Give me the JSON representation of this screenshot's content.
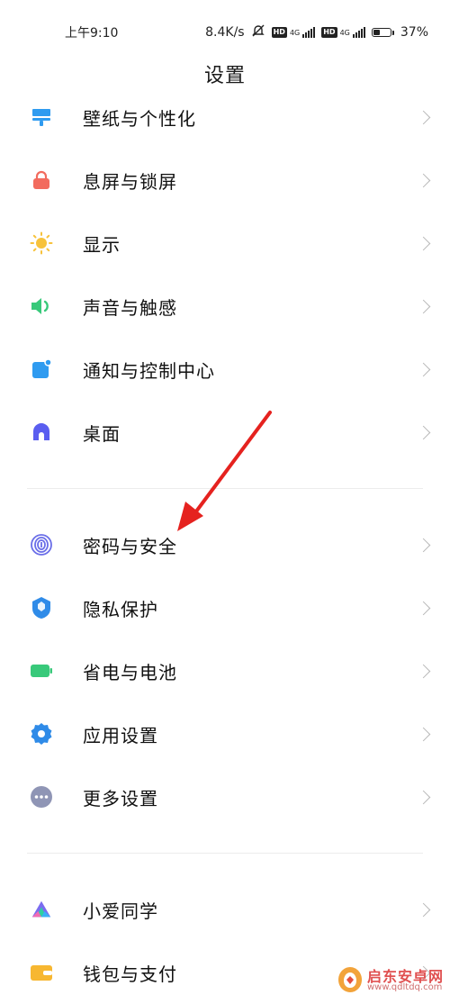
{
  "status": {
    "time": "上午9:10",
    "speed": "8.4K/s",
    "sim1": "HD",
    "net1": "4G",
    "sim2": "HD",
    "net2": "4G",
    "battery": "37%",
    "battery_level": 0.37
  },
  "page": {
    "title": "设置"
  },
  "groups": [
    {
      "items": [
        {
          "label": "壁纸与个性化",
          "icon": "wallpaper-icon",
          "color": "#2f9bf0"
        },
        {
          "label": "息屏与锁屏",
          "icon": "lock-icon",
          "color": "#f26b5e"
        },
        {
          "label": "显示",
          "icon": "sun-icon",
          "color": "#f7c23b"
        },
        {
          "label": "声音与触感",
          "icon": "speaker-icon",
          "color": "#38c97a"
        },
        {
          "label": "通知与控制中心",
          "icon": "notification-icon",
          "color": "#2f9bf0"
        },
        {
          "label": "桌面",
          "icon": "home-icon",
          "color": "#5a5ef0"
        }
      ]
    },
    {
      "items": [
        {
          "label": "密码与安全",
          "icon": "fingerprint-icon",
          "color": "#6a6ee8"
        },
        {
          "label": "隐私保护",
          "icon": "privacy-shield-icon",
          "color": "#2f8be8"
        },
        {
          "label": "省电与电池",
          "icon": "battery-icon",
          "color": "#38c97a"
        },
        {
          "label": "应用设置",
          "icon": "gear-icon",
          "color": "#2f8be8"
        },
        {
          "label": "更多设置",
          "icon": "more-icon",
          "color": "#8f95b5"
        }
      ]
    },
    {
      "items": [
        {
          "label": "小爱同学",
          "icon": "xiaoai-icon",
          "color": "#5a7cf0"
        },
        {
          "label": "钱包与支付",
          "icon": "wallet-icon",
          "color": "#f7b731"
        }
      ]
    }
  ],
  "watermark": {
    "name": "启东安卓网",
    "url": "www.qdltdq.com"
  }
}
